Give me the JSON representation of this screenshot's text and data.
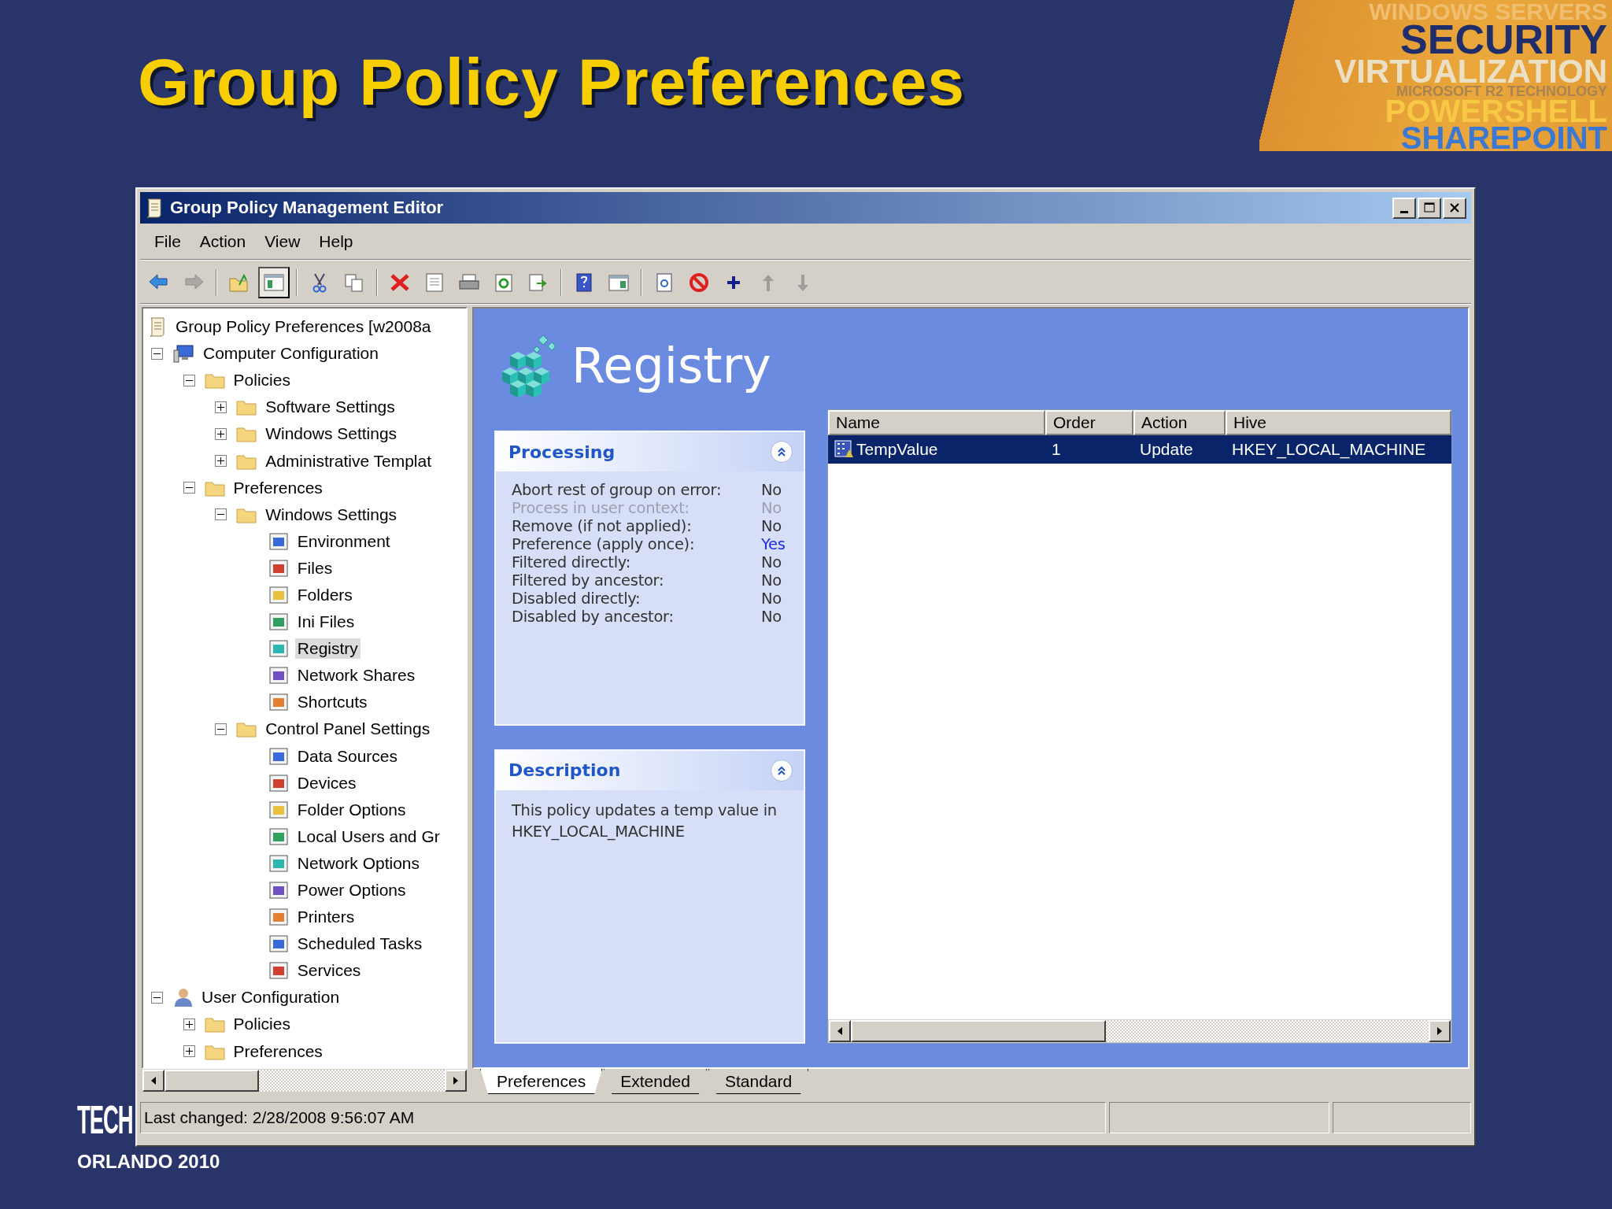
{
  "slide": {
    "title": "Group Policy Preferences",
    "banner": [
      "WINDOWS SERVERS",
      "SECURITY",
      "VIRTUALIZATION",
      "MICROSOFT R2 TECHNOLOGY",
      "POWERSHELL",
      "SHAREPOINT"
    ],
    "event_logo": {
      "mark": "TECH",
      "place": "ORLANDO 2010"
    }
  },
  "window": {
    "title": "Group Policy Management Editor",
    "menu": [
      "File",
      "Action",
      "View",
      "Help"
    ],
    "toolbar": [
      {
        "pressed": false,
        "disabled": false
      },
      {
        "pressed": false,
        "disabled": true
      },
      {
        "pressed": false,
        "disabled": false
      },
      {
        "pressed": true,
        "disabled": false
      },
      {
        "pressed": false,
        "disabled": false
      },
      {
        "pressed": false,
        "disabled": false
      },
      {
        "pressed": false,
        "disabled": false
      },
      {
        "pressed": false,
        "disabled": false
      },
      {
        "pressed": false,
        "disabled": false
      },
      {
        "pressed": false,
        "disabled": false
      },
      {
        "pressed": false,
        "disabled": false
      },
      {
        "pressed": false,
        "disabled": false
      },
      {
        "pressed": false,
        "disabled": false
      },
      {
        "pressed": false,
        "disabled": false
      },
      {
        "pressed": false,
        "disabled": false
      },
      {
        "pressed": false,
        "disabled": false
      },
      {
        "pressed": false,
        "disabled": true
      },
      {
        "pressed": false,
        "disabled": true
      }
    ],
    "tree": {
      "label": "Group Policy Preferences [w2008a",
      "selected": false,
      "children": [
        {
          "label": "Computer Configuration",
          "selected": false,
          "expanded": true,
          "children": [
            {
              "label": "Policies",
              "selected": false,
              "expanded": true,
              "children": [
                {
                  "label": "Software Settings",
                  "selected": false,
                  "expanded": false
                },
                {
                  "label": "Windows Settings",
                  "selected": false,
                  "expanded": false
                },
                {
                  "label": "Administrative Templat",
                  "selected": false,
                  "expanded": false
                }
              ]
            },
            {
              "label": "Preferences",
              "selected": false,
              "expanded": true,
              "children": [
                {
                  "label": "Windows Settings",
                  "selected": false,
                  "expanded": true,
                  "children": [
                    {
                      "label": "Environment",
                      "selected": false
                    },
                    {
                      "label": "Files",
                      "selected": false
                    },
                    {
                      "label": "Folders",
                      "selected": false
                    },
                    {
                      "label": "Ini Files",
                      "selected": false
                    },
                    {
                      "label": "Registry",
                      "selected": true
                    },
                    {
                      "label": "Network Shares",
                      "selected": false
                    },
                    {
                      "label": "Shortcuts",
                      "selected": false
                    }
                  ]
                },
                {
                  "label": "Control Panel Settings",
                  "selected": false,
                  "expanded": true,
                  "children": [
                    {
                      "label": "Data Sources",
                      "selected": false
                    },
                    {
                      "label": "Devices",
                      "selected": false
                    },
                    {
                      "label": "Folder Options",
                      "selected": false
                    },
                    {
                      "label": "Local Users and Gr",
                      "selected": false
                    },
                    {
                      "label": "Network Options",
                      "selected": false
                    },
                    {
                      "label": "Power Options",
                      "selected": false
                    },
                    {
                      "label": "Printers",
                      "selected": false
                    },
                    {
                      "label": "Scheduled Tasks",
                      "selected": false
                    },
                    {
                      "label": "Services",
                      "selected": false
                    }
                  ]
                }
              ]
            }
          ]
        },
        {
          "label": "User Configuration",
          "selected": false,
          "expanded": true,
          "children": [
            {
              "label": "Policies",
              "selected": false,
              "expanded": false
            },
            {
              "label": "Preferences",
              "selected": false,
              "expanded": false
            }
          ]
        }
      ]
    },
    "pane_title": "Registry",
    "processing": {
      "title": "Processing",
      "expanded": true,
      "rows": [
        {
          "label": "Abort rest of group on error:",
          "value": "No",
          "disabled": false,
          "emphasized": false
        },
        {
          "label": "Process in user context:",
          "value": "No",
          "disabled": true,
          "emphasized": false
        },
        {
          "label": "Remove (if not applied):",
          "value": "No",
          "disabled": false,
          "emphasized": false
        },
        {
          "label": "Preference (apply once):",
          "value": "Yes",
          "disabled": false,
          "emphasized": true
        },
        {
          "label": "Filtered directly:",
          "value": "No",
          "disabled": false,
          "emphasized": false
        },
        {
          "label": "Filtered by ancestor:",
          "value": "No",
          "disabled": false,
          "emphasized": false
        },
        {
          "label": "Disabled directly:",
          "value": "No",
          "disabled": false,
          "emphasized": false
        },
        {
          "label": "Disabled by ancestor:",
          "value": "No",
          "disabled": false,
          "emphasized": false
        }
      ]
    },
    "description": {
      "title": "Description",
      "expanded": true,
      "text": "This policy updates a temp value in HKEY_LOCAL_MACHINE"
    },
    "table": {
      "columns": [
        "Name",
        "Order",
        "Action",
        "Hive"
      ],
      "rows": [
        {
          "cells": [
            "TempValue",
            "1",
            "Update",
            "HKEY_LOCAL_MACHINE"
          ],
          "selected": true
        }
      ]
    },
    "tabs": [
      {
        "label": "Preferences",
        "selected": true
      },
      {
        "label": "Extended",
        "selected": false
      },
      {
        "label": "Standard",
        "selected": false
      }
    ],
    "status_bar": "Last changed: 2/28/2008 9:56:07 AM"
  }
}
